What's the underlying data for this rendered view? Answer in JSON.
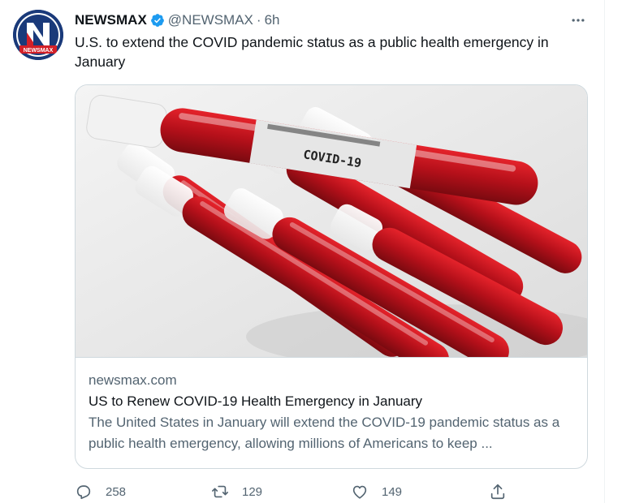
{
  "tweet": {
    "display_name": "NEWSMAX",
    "handle": "@NEWSMAX",
    "separator": "·",
    "time": "6h",
    "text": "U.S. to extend the COVID pandemic status as a public health emergency in January",
    "avatar_label": "NEWSMAX",
    "avatar_letter": "N"
  },
  "card": {
    "image_label": "COVID-19",
    "domain": "newsmax.com",
    "title": "US to Renew COVID-19 Health Emergency in January",
    "description": "The United States in January will extend the COVID-19 pandemic status as a public health emergency, allowing millions of Americans to keep ..."
  },
  "actions": {
    "replies": "258",
    "retweets": "129",
    "likes": "149"
  },
  "colors": {
    "verified": "#1d9bf0",
    "secondary_text": "#536471",
    "border": "#cfd9de",
    "brand_red": "#d32028",
    "brand_navy": "#1a3a7a"
  },
  "icons": [
    "verified-badge-icon",
    "more-icon",
    "reply-icon",
    "retweet-icon",
    "like-icon",
    "share-icon"
  ]
}
